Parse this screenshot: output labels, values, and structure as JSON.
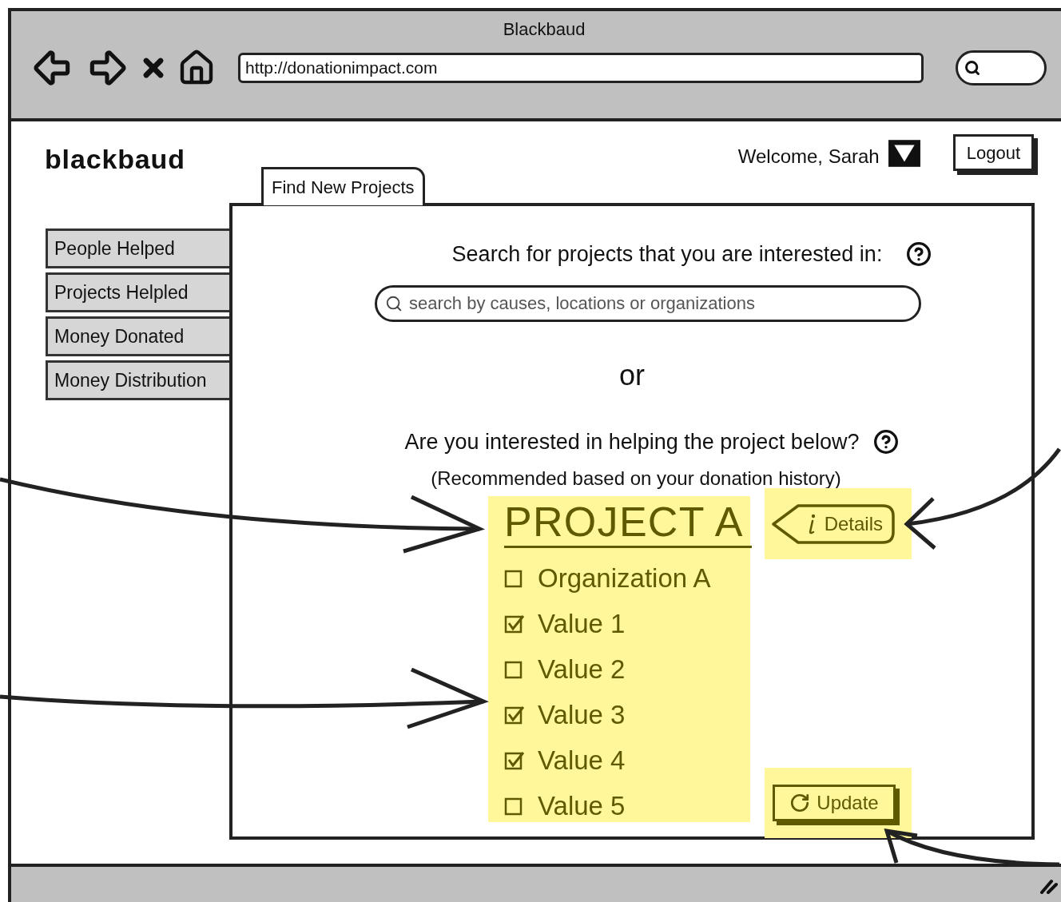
{
  "window": {
    "title": "Blackbaud"
  },
  "toolbar": {
    "url": "http://donationimpact.com"
  },
  "header": {
    "logo": "blackbaud",
    "welcome": "Welcome, Sarah",
    "logout": "Logout"
  },
  "sidebar": {
    "items": [
      {
        "label": "People Helped"
      },
      {
        "label": "Projects Helpled"
      },
      {
        "label": "Money Donated"
      },
      {
        "label": "Money Distribution"
      }
    ]
  },
  "tabs": [
    {
      "label": "Find New Projects",
      "selected": true
    }
  ],
  "search": {
    "prompt": "Search for projects that you are interested in:",
    "placeholder": "search by causes, locations or organizations"
  },
  "divider_text": "or",
  "recommendation": {
    "question": "Are you interested in helping the project below?",
    "note": "(Recommended based on your donation history)",
    "project_title": "PROJECT A",
    "details": "Details",
    "update": "Update",
    "items": [
      {
        "label": "Organization A",
        "checked": false
      },
      {
        "label": "Value 1",
        "checked": true
      },
      {
        "label": "Value 2",
        "checked": false
      },
      {
        "label": "Value 3",
        "checked": true
      },
      {
        "label": "Value 4",
        "checked": true
      },
      {
        "label": "Value 5",
        "checked": false
      }
    ]
  }
}
